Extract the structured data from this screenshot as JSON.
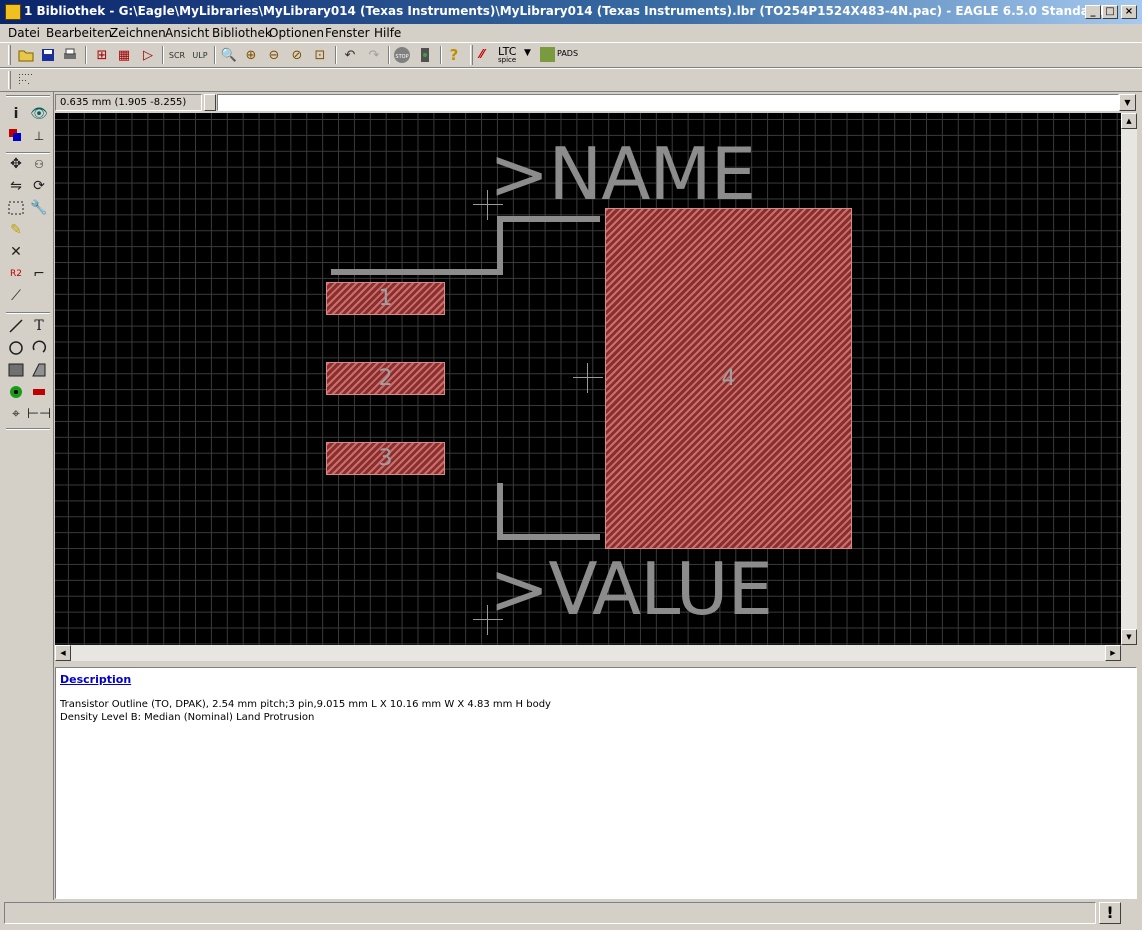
{
  "window": {
    "title": "1 Bibliothek - G:\\Eagle\\MyLibraries\\MyLibrary014 (Texas Instruments)\\MyLibrary014 (Texas Instruments).lbr (TO254P1524X483-4N.pac) - EAGLE 6.5.0 Standard"
  },
  "menu": {
    "items": [
      "Datei",
      "Bearbeiten",
      "Zeichnen",
      "Ansicht",
      "Bibliothek",
      "Optionen",
      "Fenster",
      "Hilfe"
    ]
  },
  "toolbar": {
    "ltc_label": "LTC",
    "ltc_sub": "spice",
    "pads_label": "PADS",
    "stop_label": "STOP",
    "help_label": "?"
  },
  "coords": {
    "text": "0.635 mm (1.905 -8.255)"
  },
  "command": {
    "value": ""
  },
  "canvas": {
    "name_text": ">NAME",
    "value_text": ">VALUE",
    "pads": [
      "1",
      "2",
      "3",
      "4"
    ]
  },
  "description": {
    "title": "Description",
    "line1": "Transistor Outline (TO, DPAK), 2.54 mm pitch;3 pin,9.015 mm L X 10.16 mm W X 4.83 mm H body",
    "line2": "Density Level B: Median (Nominal) Land Protrusion"
  },
  "status": {
    "text": "",
    "stop_symbol": "!"
  }
}
